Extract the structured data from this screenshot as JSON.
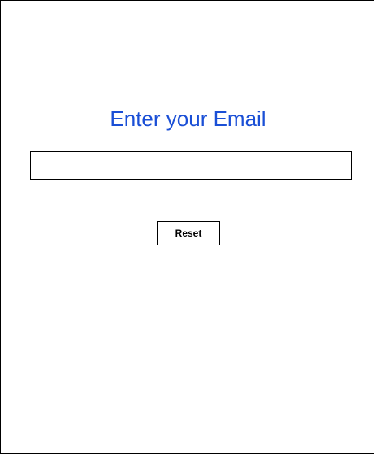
{
  "form": {
    "title": "Enter your Email",
    "email_value": "",
    "email_placeholder": "",
    "reset_label": "Reset"
  },
  "colors": {
    "title": "#1a4fd6",
    "border": "#000000",
    "background": "#ffffff"
  }
}
